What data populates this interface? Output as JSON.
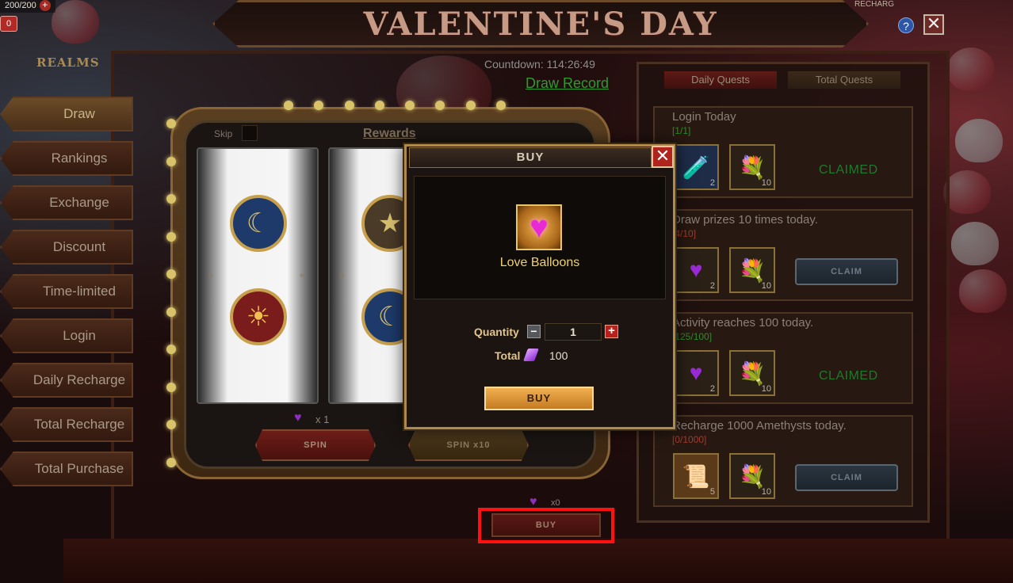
{
  "top": {
    "resource_text": "200/200",
    "red_badge": "0",
    "title": "VALENTINE'S DAY",
    "recharge_label": "RECHARG",
    "help_label": "?",
    "close_label": "✕",
    "realms_label": "REALMS"
  },
  "sidebar": {
    "items": [
      {
        "label": "Draw"
      },
      {
        "label": "Rankings"
      },
      {
        "label": "Exchange"
      },
      {
        "label": "Discount"
      },
      {
        "label": "Time-limited"
      },
      {
        "label": "Login"
      },
      {
        "label": "Daily Recharge"
      },
      {
        "label": "Total Recharge"
      },
      {
        "label": "Total Purchase"
      }
    ]
  },
  "draw": {
    "countdown": "Countdown: 114:26:49",
    "draw_record": "Draw Record",
    "skip_label": "Skip",
    "rewards_label": "Rewards",
    "heart_count": "x  1",
    "spin_label": "SPIN",
    "spin10_label": "SPIN x10",
    "bottom_heart_count": "x0",
    "buy_label": "BUY"
  },
  "quests": {
    "tabs": [
      {
        "label": "Daily Quests"
      },
      {
        "label": "Total Quests"
      }
    ],
    "items": [
      {
        "title": "Login Today",
        "progress": "[1/1]",
        "status": "CLAIMED",
        "item1_count": "2",
        "item2_count": "10"
      },
      {
        "title": "Draw prizes 10 times today.",
        "progress": "[4/10]",
        "status": "CLAIM",
        "item1_count": "2",
        "item2_count": "10"
      },
      {
        "title": "Activity reaches 100 today.",
        "progress": "[125/100]",
        "status": "CLAIMED",
        "item1_count": "2",
        "item2_count": "10"
      },
      {
        "title": "Recharge 1000 Amethysts today.",
        "progress": "[0/1000]",
        "status": "CLAIM",
        "item1_count": "5",
        "item2_count": "10"
      }
    ]
  },
  "modal": {
    "title": "BUY",
    "close_label": "✕",
    "item_name": "Love Balloons",
    "quantity_label": "Quantity",
    "quantity_value": "1",
    "minus_label": "−",
    "plus_label": "+",
    "total_label": "Total",
    "total_value": "100",
    "buy_label": "BUY"
  }
}
